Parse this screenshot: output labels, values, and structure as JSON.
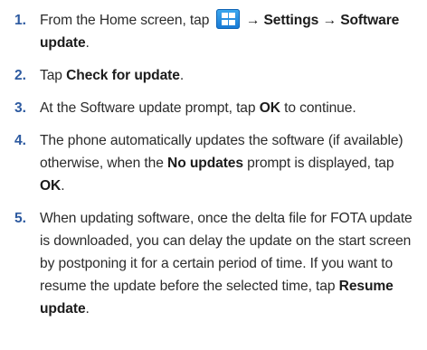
{
  "steps": [
    {
      "number": "1.",
      "text_before_icon": "From the Home screen, tap ",
      "icon": "apps-grid-icon",
      "arrow_1": " → ",
      "settings": "Settings",
      "arrow_2": " → ",
      "software_update": "Software update",
      "text_end": "."
    },
    {
      "number": "2.",
      "text_before": "Tap ",
      "bold": "Check for update",
      "text_after": "."
    },
    {
      "number": "3.",
      "text_before": "At the Software update prompt, tap ",
      "bold": "OK",
      "text_after": " to continue."
    },
    {
      "number": "4.",
      "text_before": "The phone automatically updates the software (if available) otherwise, when the ",
      "bold_1": "No updates",
      "text_middle": " prompt is displayed, tap ",
      "bold_2": "OK",
      "text_after": "."
    },
    {
      "number": "5.",
      "text_before": "When updating software, once the delta file for FOTA update is downloaded, you can delay the update on the start screen by postponing it for a certain period of time. If you want to resume the update before the selected time, tap ",
      "bold": "Resume update",
      "text_after": "."
    }
  ]
}
